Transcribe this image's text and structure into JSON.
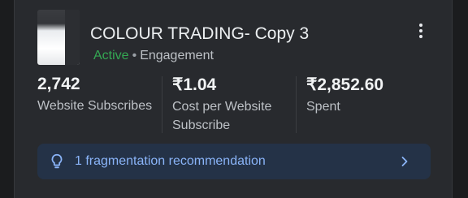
{
  "campaign": {
    "name": "COLOUR TRADING- Copy 3",
    "status": "Active",
    "separator": "•",
    "objective": "Engagement"
  },
  "metrics": [
    {
      "value": "2,742",
      "label": "Website Subscribes"
    },
    {
      "value": "₹1.04",
      "label": "Cost per Website Subscribe"
    },
    {
      "value": "₹2,852.60",
      "label": "Spent"
    }
  ],
  "recommendation": {
    "text": "1 fragmentation recommendation",
    "icon": "lightbulb-icon"
  },
  "menu": {
    "icon": "more-vert-icon"
  },
  "colors": {
    "background": "#1b1c1e",
    "card": "#282a2e",
    "active": "#34a853",
    "link": "#8ab4f8",
    "recommendation_bg": "#243247"
  }
}
